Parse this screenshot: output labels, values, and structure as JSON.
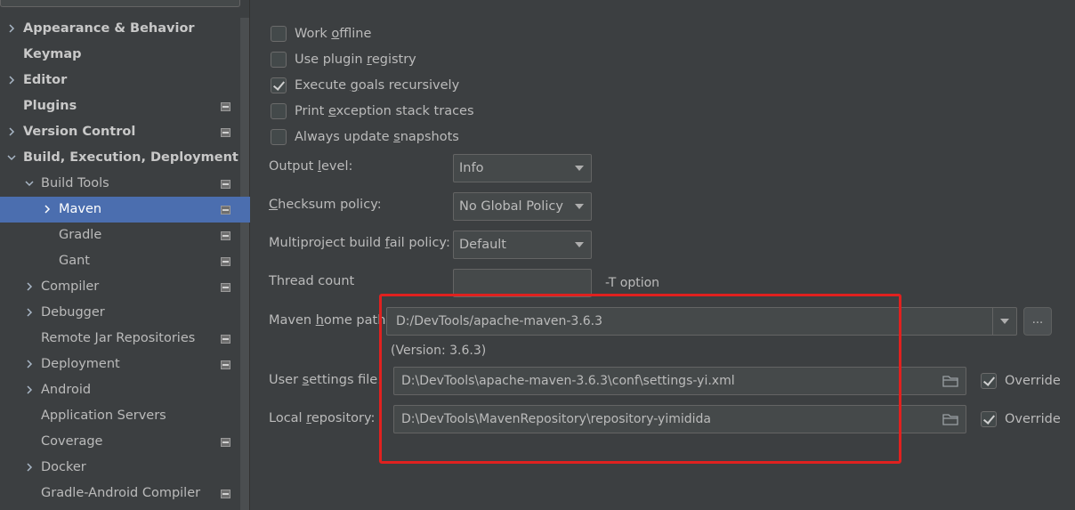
{
  "sidebar": {
    "items": [
      {
        "label": "Appearance & Behavior",
        "bold": true,
        "chevron": "right",
        "indent": 0
      },
      {
        "label": "Keymap",
        "bold": true,
        "chevron": "none",
        "indent": 0
      },
      {
        "label": "Editor",
        "bold": true,
        "chevron": "right",
        "indent": 0
      },
      {
        "label": "Plugins",
        "bold": true,
        "chevron": "none",
        "indent": 0,
        "project_icon": true
      },
      {
        "label": "Version Control",
        "bold": true,
        "chevron": "right",
        "indent": 0,
        "project_icon": true
      },
      {
        "label": "Build, Execution, Deployment",
        "bold": true,
        "chevron": "down",
        "indent": 0
      },
      {
        "label": "Build Tools",
        "bold": false,
        "chevron": "down",
        "indent": 1,
        "project_icon": true
      },
      {
        "label": "Maven",
        "bold": false,
        "chevron": "right",
        "indent": 2,
        "project_icon": true,
        "selected": true
      },
      {
        "label": "Gradle",
        "bold": false,
        "chevron": "none",
        "indent": 2,
        "project_icon": true
      },
      {
        "label": "Gant",
        "bold": false,
        "chevron": "none",
        "indent": 2,
        "project_icon": true
      },
      {
        "label": "Compiler",
        "bold": false,
        "chevron": "right",
        "indent": 1,
        "project_icon": true
      },
      {
        "label": "Debugger",
        "bold": false,
        "chevron": "right",
        "indent": 1
      },
      {
        "label": "Remote Jar Repositories",
        "bold": false,
        "chevron": "none",
        "indent": 1,
        "project_icon": true
      },
      {
        "label": "Deployment",
        "bold": false,
        "chevron": "right",
        "indent": 1,
        "project_icon": true
      },
      {
        "label": "Android",
        "bold": false,
        "chevron": "right",
        "indent": 1
      },
      {
        "label": "Application Servers",
        "bold": false,
        "chevron": "none",
        "indent": 1
      },
      {
        "label": "Coverage",
        "bold": false,
        "chevron": "none",
        "indent": 1,
        "project_icon": true
      },
      {
        "label": "Docker",
        "bold": false,
        "chevron": "right",
        "indent": 1
      },
      {
        "label": "Gradle-Android Compiler",
        "bold": false,
        "chevron": "none",
        "indent": 1,
        "project_icon": true
      }
    ]
  },
  "checkboxes": [
    {
      "label_pre": "Work ",
      "label_u": "o",
      "label_post": "ffline",
      "checked": false
    },
    {
      "label_pre": "Use plugin ",
      "label_u": "r",
      "label_post": "egistry",
      "checked": false
    },
    {
      "label_pre": "Execute ",
      "label_u": "g",
      "label_post": "oals recursively",
      "checked": true
    },
    {
      "label_pre": "Print ",
      "label_u": "e",
      "label_post": "xception stack traces",
      "checked": false
    },
    {
      "label_pre": "Always update ",
      "label_u": "s",
      "label_post": "napshots",
      "checked": false
    }
  ],
  "form": {
    "output_level": {
      "label_pre": "Output ",
      "label_u": "l",
      "label_post": "evel:",
      "value": "Info"
    },
    "checksum_policy": {
      "label_pre": "",
      "label_u": "C",
      "label_post": "hecksum policy:",
      "value": "No Global Policy"
    },
    "fail_policy": {
      "label_pre": "Multiproject build ",
      "label_u": "f",
      "label_post": "ail policy:",
      "value": "Default"
    },
    "thread_count": {
      "label": "Thread count",
      "value": "",
      "suffix": "-T option"
    },
    "maven_home": {
      "label_pre": "Maven ",
      "label_u": "h",
      "label_post": "ome path:",
      "value": "D:/DevTools/apache-maven-3.6.3",
      "version": "(Version: 3.6.3)",
      "browse": "..."
    },
    "user_settings": {
      "label_pre": "User ",
      "label_u": "s",
      "label_post": "ettings file:",
      "value": "D:\\DevTools\\apache-maven-3.6.3\\conf\\settings-yi.xml",
      "override_label": "Override",
      "override_checked": true
    },
    "local_repo": {
      "label_pre": "Local ",
      "label_u": "r",
      "label_post": "epository:",
      "value": "D:\\DevTools\\MavenRepository\\repository-yimidida",
      "override_label": "Override",
      "override_checked": true
    }
  },
  "colors": {
    "accent_selected": "#4b6eaf",
    "highlight_box": "#e0211f"
  }
}
